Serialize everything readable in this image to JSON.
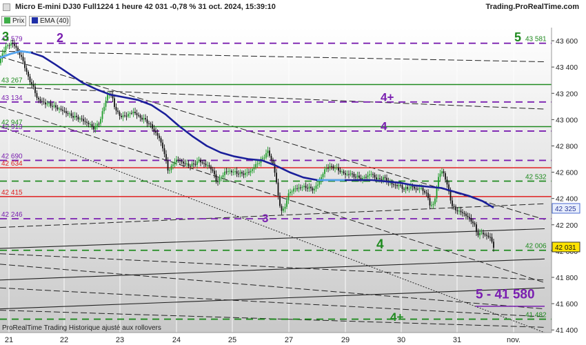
{
  "window": {
    "title": "Micro E-mini DJ30 Full1224 1 heure 42 031 -0,78 % 31 oct. 2024, 15:39:10",
    "brand": "Trading.ProRealTime.com"
  },
  "legend": [
    {
      "label": "Prix",
      "color": "#3fae49"
    },
    {
      "label": "EMA (40)",
      "color": "#1f2fa8"
    }
  ],
  "footer": "ProRealTime Trading Historique ajusté aux rollovers",
  "colors": {
    "up": "#1f9d2a",
    "down": "#111111",
    "ema": "#1a1f9a",
    "ema_light": "#55a8f0",
    "red": "#e02020",
    "purple": "#7a1fb0",
    "green": "#1f8a1f",
    "green_dash": "#2a9a2a"
  },
  "chart_data": {
    "type": "candlestick",
    "x_ticks": [
      "21",
      "22",
      "23",
      "24",
      "25",
      "27",
      "29",
      "30",
      "31",
      "nov."
    ],
    "y_ticks": [
      41400,
      41600,
      41800,
      42000,
      42200,
      42400,
      42600,
      42800,
      43000,
      43200,
      43400,
      43600
    ],
    "ylim": [
      41380,
      43700
    ],
    "anchors": [
      [
        0,
        43430
      ],
      [
        4,
        43520
      ],
      [
        10,
        43560
      ],
      [
        16,
        43580
      ],
      [
        22,
        43560
      ],
      [
        28,
        43500
      ],
      [
        34,
        43440
      ],
      [
        40,
        43330
      ],
      [
        48,
        43250
      ],
      [
        54,
        43160
      ],
      [
        62,
        43130
      ],
      [
        70,
        43120
      ],
      [
        78,
        43100
      ],
      [
        86,
        43080
      ],
      [
        94,
        43060
      ],
      [
        100,
        43040
      ],
      [
        108,
        43020
      ],
      [
        115,
        43010
      ],
      [
        123,
        42985
      ],
      [
        131,
        42960
      ],
      [
        137,
        42930
      ],
      [
        145,
        42990
      ],
      [
        151,
        43100
      ],
      [
        155,
        43180
      ],
      [
        159,
        43200
      ],
      [
        163,
        43170
      ],
      [
        167,
        43080
      ],
      [
        172,
        43040
      ],
      [
        178,
        43020
      ],
      [
        186,
        43040
      ],
      [
        194,
        43060
      ],
      [
        202,
        43020
      ],
      [
        210,
        43000
      ],
      [
        218,
        42960
      ],
      [
        224,
        42910
      ],
      [
        230,
        42870
      ],
      [
        236,
        42790
      ],
      [
        241,
        42680
      ],
      [
        244,
        42610
      ],
      [
        249,
        42640
      ],
      [
        254,
        42690
      ],
      [
        260,
        42690
      ],
      [
        266,
        42670
      ],
      [
        274,
        42650
      ],
      [
        282,
        42660
      ],
      [
        288,
        42690
      ],
      [
        294,
        42670
      ],
      [
        300,
        42650
      ],
      [
        305,
        42640
      ],
      [
        310,
        42590
      ],
      [
        315,
        42520
      ],
      [
        320,
        42560
      ],
      [
        326,
        42600
      ],
      [
        332,
        42610
      ],
      [
        340,
        42600
      ],
      [
        348,
        42590
      ],
      [
        356,
        42590
      ],
      [
        364,
        42610
      ],
      [
        370,
        42650
      ],
      [
        376,
        42680
      ],
      [
        382,
        42710
      ],
      [
        388,
        42760
      ],
      [
        392,
        42720
      ],
      [
        396,
        42660
      ],
      [
        400,
        42560
      ],
      [
        404,
        42400
      ],
      [
        408,
        42300
      ],
      [
        412,
        42320
      ],
      [
        416,
        42390
      ],
      [
        420,
        42450
      ],
      [
        426,
        42470
      ],
      [
        432,
        42480
      ],
      [
        440,
        42490
      ],
      [
        448,
        42480
      ],
      [
        456,
        42470
      ],
      [
        462,
        42520
      ],
      [
        466,
        42560
      ],
      [
        472,
        42630
      ],
      [
        478,
        42640
      ],
      [
        484,
        42640
      ],
      [
        490,
        42620
      ],
      [
        496,
        42600
      ],
      [
        502,
        42580
      ],
      [
        508,
        42590
      ],
      [
        514,
        42570
      ],
      [
        520,
        42560
      ],
      [
        526,
        42550
      ],
      [
        532,
        42570
      ],
      [
        538,
        42590
      ],
      [
        544,
        42560
      ],
      [
        550,
        42540
      ],
      [
        556,
        42560
      ],
      [
        562,
        42530
      ],
      [
        568,
        42510
      ],
      [
        574,
        42500
      ],
      [
        580,
        42500
      ],
      [
        586,
        42470
      ],
      [
        592,
        42480
      ],
      [
        598,
        42490
      ],
      [
        604,
        42470
      ],
      [
        610,
        42480
      ],
      [
        616,
        42450
      ],
      [
        620,
        42420
      ],
      [
        624,
        42350
      ],
      [
        628,
        42340
      ],
      [
        632,
        42430
      ],
      [
        636,
        42560
      ],
      [
        640,
        42610
      ],
      [
        644,
        42590
      ],
      [
        648,
        42510
      ],
      [
        652,
        42430
      ],
      [
        656,
        42340
      ],
      [
        660,
        42320
      ],
      [
        666,
        42300
      ],
      [
        672,
        42290
      ],
      [
        678,
        42260
      ],
      [
        684,
        42230
      ],
      [
        688,
        42200
      ],
      [
        692,
        42130
      ],
      [
        696,
        42130
      ],
      [
        700,
        42140
      ],
      [
        704,
        42120
      ],
      [
        708,
        42110
      ],
      [
        712,
        42100
      ],
      [
        716,
        42031
      ]
    ],
    "ema": [
      [
        0,
        43470
      ],
      [
        15,
        43500
      ],
      [
        30,
        43520
      ],
      [
        45,
        43510
      ],
      [
        62,
        43480
      ],
      [
        80,
        43420
      ],
      [
        100,
        43350
      ],
      [
        120,
        43280
      ],
      [
        140,
        43230
      ],
      [
        160,
        43190
      ],
      [
        180,
        43170
      ],
      [
        200,
        43150
      ],
      [
        220,
        43110
      ],
      [
        240,
        43040
      ],
      [
        260,
        42950
      ],
      [
        280,
        42870
      ],
      [
        300,
        42800
      ],
      [
        320,
        42750
      ],
      [
        340,
        42720
      ],
      [
        360,
        42700
      ],
      [
        380,
        42690
      ],
      [
        400,
        42650
      ],
      [
        420,
        42600
      ],
      [
        440,
        42560
      ],
      [
        460,
        42540
      ],
      [
        480,
        42540
      ],
      [
        500,
        42540
      ],
      [
        520,
        42540
      ],
      [
        540,
        42540
      ],
      [
        560,
        42530
      ],
      [
        580,
        42520
      ],
      [
        600,
        42500
      ],
      [
        620,
        42490
      ],
      [
        640,
        42480
      ],
      [
        660,
        42450
      ],
      [
        680,
        42420
      ],
      [
        700,
        42380
      ],
      [
        716,
        42330
      ]
    ],
    "levels": [
      {
        "y": 43581,
        "style": "dash",
        "color": "purple",
        "label": "43 579",
        "label_side": "left"
      },
      {
        "y": 43267,
        "style": "solid",
        "color": "green",
        "label": "43 267",
        "label_side": "left"
      },
      {
        "y": 43134,
        "style": "dash",
        "color": "purple",
        "label": "43 134",
        "label_side": "left"
      },
      {
        "y": 42947,
        "style": "solid",
        "color": "green",
        "label": "42 947",
        "label_side": "left"
      },
      {
        "y": 42913,
        "style": "dash",
        "color": "purple",
        "label": "42 913",
        "label_side": "left"
      },
      {
        "y": 42690,
        "style": "dash",
        "color": "purple",
        "label": "42 690",
        "label_side": "left"
      },
      {
        "y": 42634,
        "style": "solid",
        "color": "red",
        "label": "42 634",
        "label_side": "left"
      },
      {
        "y": 42532,
        "style": "dash",
        "color": "green",
        "label": "42 532",
        "label_side": "right"
      },
      {
        "y": 42415,
        "style": "solid",
        "color": "red",
        "label": "42 415",
        "label_side": "left"
      },
      {
        "y": 42246,
        "style": "dash",
        "color": "purple",
        "label": "42 246",
        "label_side": "left"
      },
      {
        "y": 42006,
        "style": "dash",
        "color": "green",
        "label": "42 006",
        "label_side": "right"
      },
      {
        "y": 41580,
        "style": "solid",
        "color": "purple",
        "label": "",
        "label_side": "none"
      },
      {
        "y": 41482,
        "style": "dash",
        "color": "green",
        "label": "41 482",
        "label_side": "right"
      }
    ],
    "trendlines": [
      {
        "from": [
          0,
          43480
        ],
        "to": [
          790,
          42240
        ],
        "style": "dashdot"
      },
      {
        "from": [
          0,
          43100
        ],
        "to": [
          790,
          41760
        ],
        "style": "dashdot"
      },
      {
        "from": [
          0,
          42950
        ],
        "to": [
          790,
          41380
        ],
        "style": "dotted"
      },
      {
        "from": [
          0,
          42020
        ],
        "to": [
          790,
          42170
        ],
        "style": "solid"
      },
      {
        "from": [
          0,
          41780
        ],
        "to": [
          790,
          41940
        ],
        "style": "solid"
      },
      {
        "from": [
          0,
          41560
        ],
        "to": [
          790,
          41720
        ],
        "style": "solid"
      },
      {
        "from": [
          0,
          43520
        ],
        "to": [
          790,
          43440
        ],
        "style": "dashdot"
      },
      {
        "from": [
          0,
          43250
        ],
        "to": [
          790,
          43080
        ],
        "style": "dashdot"
      },
      {
        "from": [
          0,
          42180
        ],
        "to": [
          790,
          42360
        ],
        "style": "dashdot"
      },
      {
        "from": [
          0,
          41980
        ],
        "to": [
          790,
          41780
        ],
        "style": "dashdot"
      },
      {
        "from": [
          0,
          41900
        ],
        "to": [
          790,
          41560
        ],
        "style": "dashdot"
      },
      {
        "from": [
          0,
          41720
        ],
        "to": [
          790,
          41500
        ],
        "style": "dashdot"
      },
      {
        "from": [
          0,
          41550
        ],
        "to": [
          790,
          41420
        ],
        "style": "dashdot"
      }
    ],
    "annotations": [
      {
        "text": "3",
        "x": 3,
        "y": 43600,
        "color": "green",
        "size": 18
      },
      {
        "text": "2",
        "x": 82,
        "y": 43590,
        "color": "purple",
        "size": 18
      },
      {
        "text": "5",
        "x": 746,
        "y": 43595,
        "color": "green",
        "size": 18
      },
      {
        "text": "4+",
        "x": 552,
        "y": 43140,
        "color": "purple",
        "size": 17
      },
      {
        "text": "4",
        "x": 552,
        "y": 42920,
        "color": "purple",
        "size": 17
      },
      {
        "text": "3",
        "x": 380,
        "y": 42220,
        "color": "purple",
        "size": 17
      },
      {
        "text": "4",
        "x": 546,
        "y": 42020,
        "color": "green",
        "size": 19
      },
      {
        "text": "5 - 41 580",
        "x": 690,
        "y": 41640,
        "color": "purple",
        "size": 19
      },
      {
        "text": "4+",
        "x": 566,
        "y": 41470,
        "color": "green",
        "size": 17
      }
    ],
    "right_labels": [
      {
        "text": "43 581",
        "y": 43581,
        "color": "green"
      },
      {
        "text": "42 325",
        "y": 42325,
        "color": "blue_box"
      },
      {
        "text": "42 031",
        "y": 42031,
        "color": "yellow_box"
      }
    ]
  }
}
